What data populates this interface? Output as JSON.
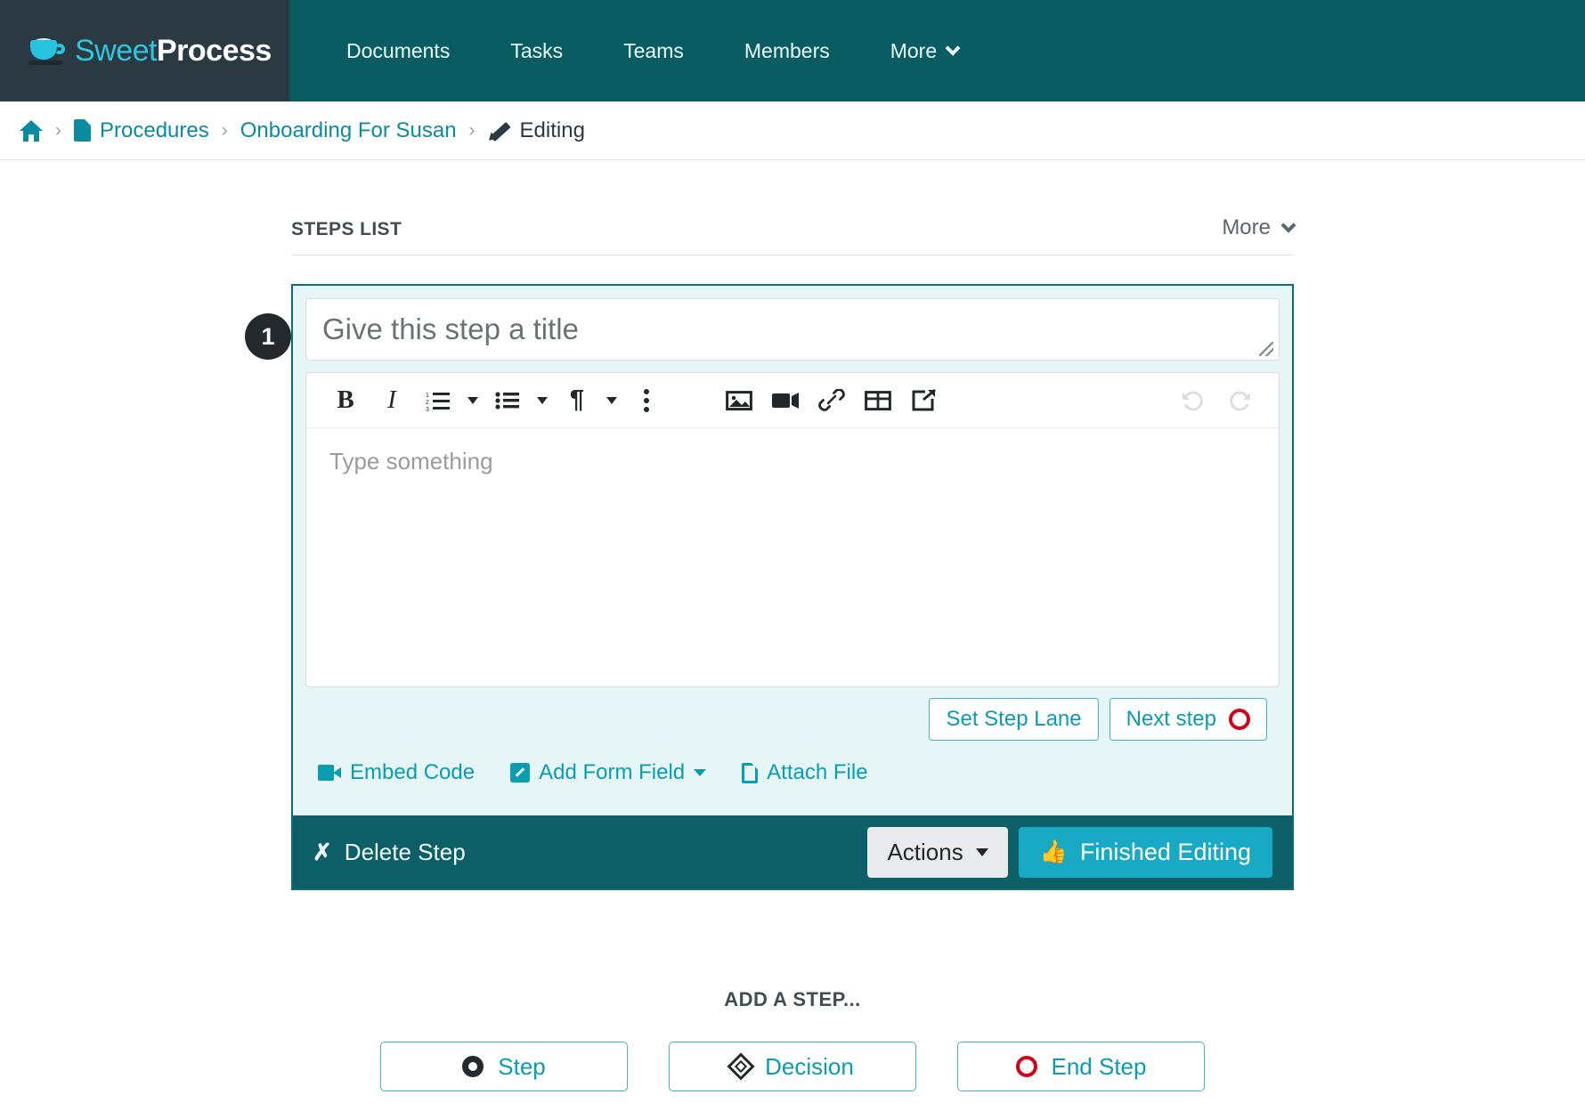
{
  "brand": {
    "part1": "Sweet",
    "part2": "Process",
    "logo_icon": "coffee-cup-icon"
  },
  "nav": {
    "items": [
      {
        "label": "Documents"
      },
      {
        "label": "Tasks"
      },
      {
        "label": "Teams"
      },
      {
        "label": "Members"
      },
      {
        "label": "More"
      }
    ]
  },
  "breadcrumb": {
    "home_icon": "home-icon",
    "doc_icon": "document-icon",
    "procedures": "Procedures",
    "document_name": "Onboarding For Susan",
    "edit_icon": "pencil-icon",
    "current": "Editing",
    "separator": "›"
  },
  "steps_section": {
    "title": "STEPS LIST",
    "more_label": "More"
  },
  "step": {
    "number": "1",
    "title_placeholder": "Give this step a title",
    "body_placeholder": "Type something",
    "toolbar": [
      {
        "name": "bold",
        "glyph": "B"
      },
      {
        "name": "italic",
        "glyph": "I"
      },
      {
        "name": "ordered-list",
        "glyph": "1."
      },
      {
        "name": "unordered-list",
        "glyph": "•"
      },
      {
        "name": "paragraph",
        "glyph": "¶"
      },
      {
        "name": "more-options",
        "glyph": "⋮"
      },
      {
        "name": "insert-image",
        "glyph": "ὛC"
      },
      {
        "name": "insert-video",
        "glyph": "video"
      },
      {
        "name": "insert-link",
        "glyph": "ὑ7"
      },
      {
        "name": "insert-table",
        "glyph": "table"
      },
      {
        "name": "external-link",
        "glyph": "↗"
      },
      {
        "name": "undo",
        "glyph": "↶"
      },
      {
        "name": "redo",
        "glyph": "↷"
      }
    ],
    "set_step_lane": "Set Step Lane",
    "next_step": "Next step",
    "embed_code": "Embed Code",
    "add_form_field": "Add Form Field",
    "attach_file": "Attach File",
    "delete_step": "Delete Step",
    "actions": "Actions",
    "finished_editing": "Finished Editing"
  },
  "add_step": {
    "label": "ADD A STEP...",
    "buttons": [
      {
        "label": "Step",
        "icon": "filled-circle-icon"
      },
      {
        "label": "Decision",
        "icon": "diamond-icon"
      },
      {
        "label": "End Step",
        "icon": "red-ring-icon"
      }
    ]
  },
  "colors": {
    "brand_dark": "#2b3a42",
    "nav_teal": "#0a5c63",
    "accent_teal": "#0a9cb3",
    "card_border": "#0c6e75",
    "card_bg": "#e6f5f6",
    "footer_teal": "#0c5f66",
    "primary_button": "#18a9c4",
    "red": "#d0021b"
  }
}
